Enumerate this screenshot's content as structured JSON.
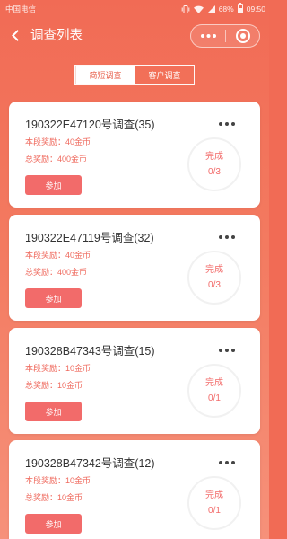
{
  "status_bar": {
    "carrier": "中国电信",
    "battery": "68%",
    "time": "09:50",
    "icons": [
      "vibrate-icon",
      "wifi-icon",
      "signal-icon",
      "battery-icon"
    ]
  },
  "header": {
    "title": "调查列表",
    "back_icon": "chevron-left-icon",
    "capsule_more_icon": "more-dots-icon",
    "capsule_close_icon": "target-circle-icon"
  },
  "tabs": [
    {
      "label": "简短调查",
      "active": true
    },
    {
      "label": "客户调查",
      "active": false
    }
  ],
  "labels": {
    "segment_reward": "本段奖励：",
    "total_reward": "总奖励：",
    "join": "参加",
    "status": "完成"
  },
  "surveys": [
    {
      "title": "190322E47120号调查(35)",
      "segment_reward": "40金币",
      "total_reward": "400金币",
      "progress": "0/3"
    },
    {
      "title": "190322E47119号调查(32)",
      "segment_reward": "40金币",
      "total_reward": "400金币",
      "progress": "0/3"
    },
    {
      "title": "190328B47343号调查(15)",
      "segment_reward": "10金币",
      "total_reward": "10金币",
      "progress": "0/1"
    },
    {
      "title": "190328B47342号调查(12)",
      "segment_reward": "10金币",
      "total_reward": "10金币",
      "progress": "0/1"
    }
  ],
  "colors": {
    "theme": "#f16b55",
    "theme_light": "#f6917a",
    "accent": "#f26b6a",
    "reward_text": "#ef6a5e",
    "title_text": "#333333"
  }
}
